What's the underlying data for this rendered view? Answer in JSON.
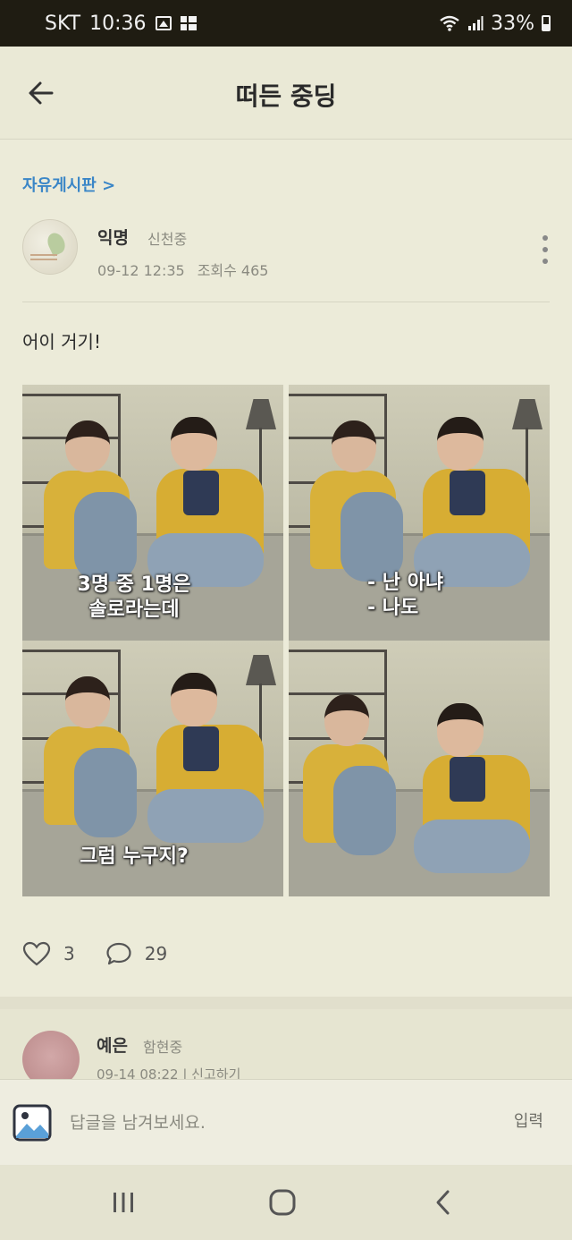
{
  "status_bar": {
    "carrier": "SKT",
    "time": "10:36",
    "battery": "33%"
  },
  "header": {
    "title": "떠든 중딩"
  },
  "post": {
    "board_link": "자유게시판 >",
    "author": "익명",
    "school": "신천중",
    "date": "09-12 12:35",
    "views": "조회수 465",
    "body": "어이 거기!",
    "captions": {
      "panel1_line1": "3명 중 1명은",
      "panel1_line2": "솔로라는데",
      "panel2_line1": "- 난 아냐",
      "panel2_line2": "- 나도",
      "panel3_line1": "그럼 누구지?"
    },
    "likes": "3",
    "comments": "29"
  },
  "comment": {
    "author": "예은",
    "school": "함현중",
    "meta": "09-14 08:22 | 신고하기"
  },
  "reply_bar": {
    "placeholder": "답글을 남겨보세요.",
    "submit_label": "입력"
  },
  "colors": {
    "accent": "#3a86c7",
    "background": "#ecebd9",
    "status_bar": "#1f1c12"
  }
}
